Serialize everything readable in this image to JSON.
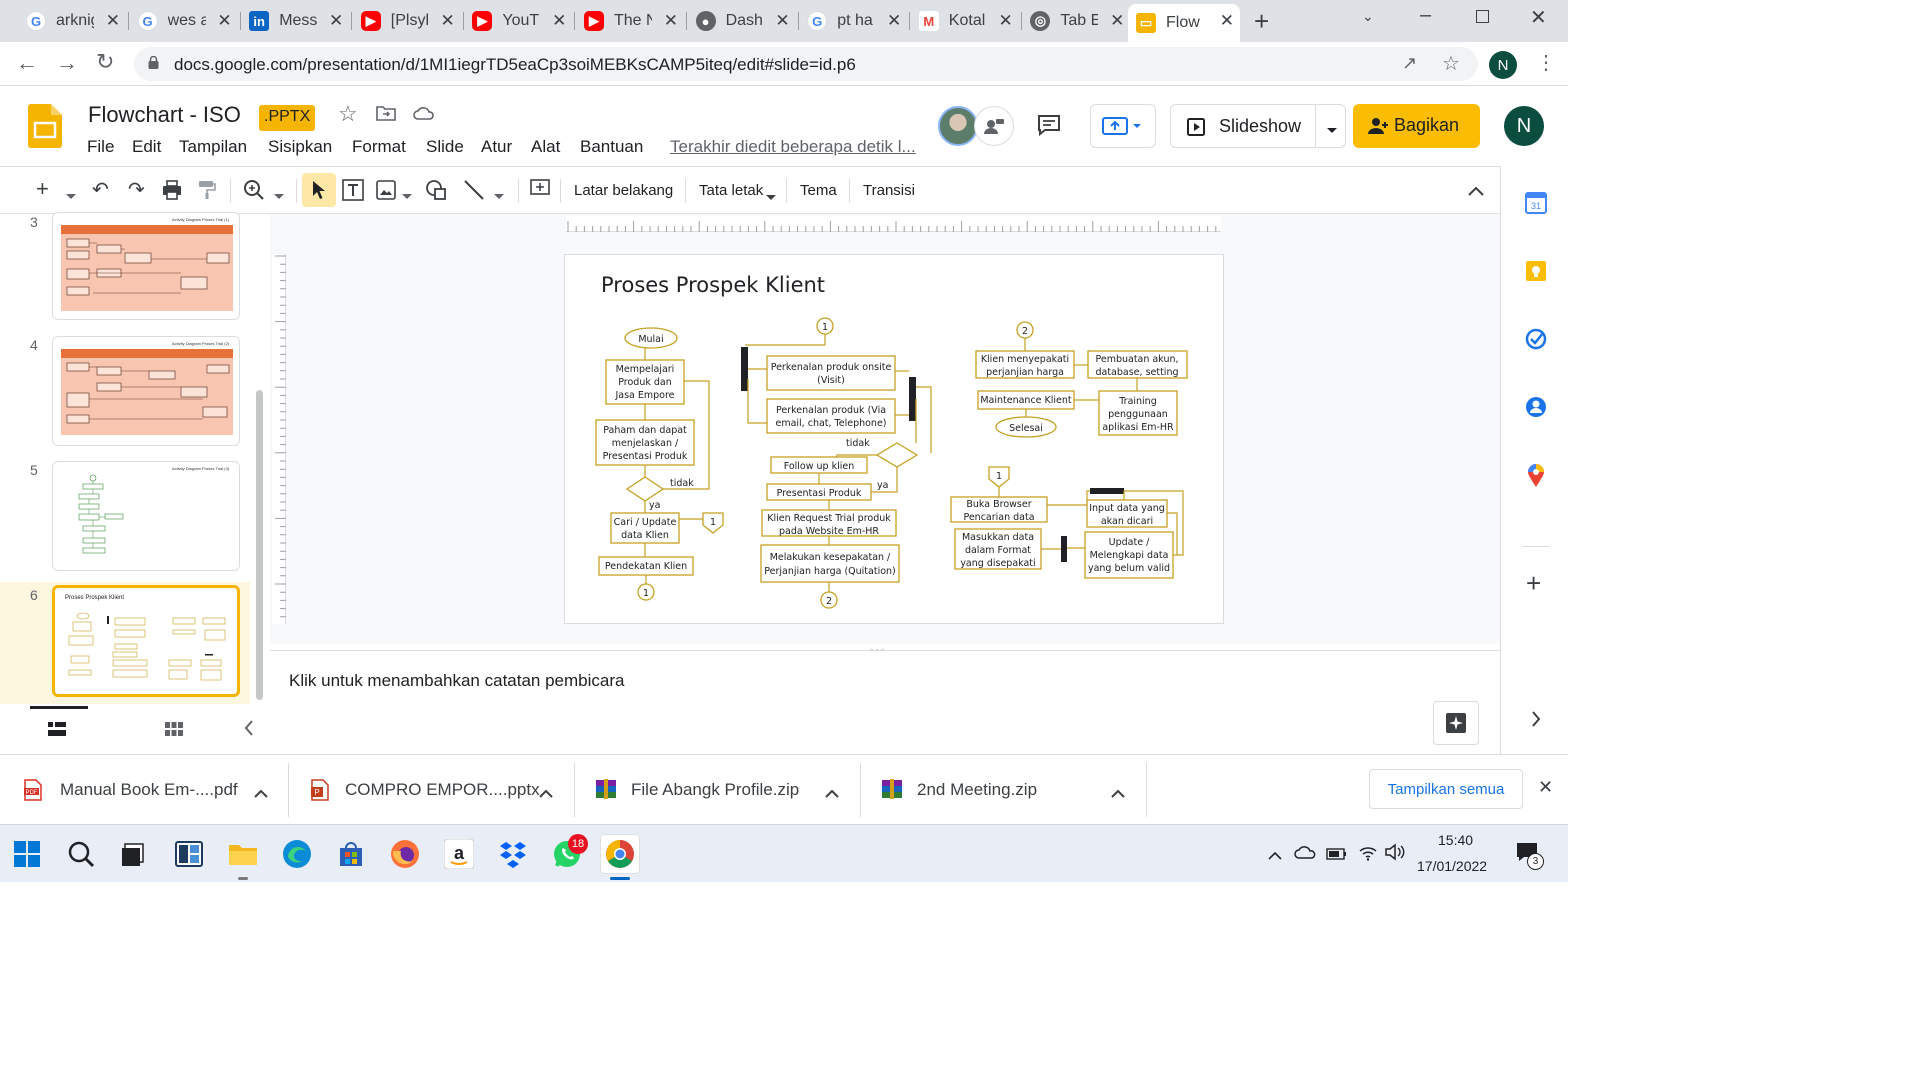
{
  "browser": {
    "tabs": [
      {
        "title": "arknig",
        "icon": "google-icon"
      },
      {
        "title": "wes a",
        "icon": "google-icon"
      },
      {
        "title": "Mess",
        "icon": "linkedin-icon"
      },
      {
        "title": "[Plsyl",
        "icon": "youtube-icon"
      },
      {
        "title": "YouT",
        "icon": "youtube-icon"
      },
      {
        "title": "The N",
        "icon": "youtube-icon"
      },
      {
        "title": "Dash",
        "icon": "globe-icon"
      },
      {
        "title": "pt ha",
        "icon": "google-icon"
      },
      {
        "title": "Kotal",
        "icon": "gmail-icon"
      },
      {
        "title": "Tab E",
        "icon": "chrome-icon"
      },
      {
        "title": "Flow",
        "icon": "slides-icon"
      }
    ],
    "url": "docs.google.com/presentation/d/1MI1iegrTD5eaCp3soiMEBKsCAMP5iteq/edit#slide=id.p6",
    "profile_initial": "N"
  },
  "app": {
    "title": "Flowchart - ISO",
    "badge": ".PPTX",
    "menu": [
      "File",
      "Edit",
      "Tampilan",
      "Sisipkan",
      "Format",
      "Slide",
      "Atur",
      "Alat",
      "Bantuan"
    ],
    "last_edit": "Terakhir diedit beberapa detik l...",
    "slideshow_label": "Slideshow",
    "share_label": "Bagikan",
    "user_initial": "N"
  },
  "toolbar": {
    "buttons": [
      "Latar belakang",
      "Tata letak",
      "Tema",
      "Transisi"
    ]
  },
  "filmstrip": {
    "slides": [
      {
        "num": "3",
        "caption": "Activity Diagram Proses Trial (1)"
      },
      {
        "num": "4",
        "caption": "Activity Diagram Proses Trial (2)"
      },
      {
        "num": "5",
        "caption": "Activity Diagram Proses Trial (3)"
      },
      {
        "num": "6",
        "caption": "Proses Prospek Klient"
      }
    ]
  },
  "slide": {
    "title": "Proses Prospek Klient",
    "nodes": {
      "mulai": "Mulai",
      "mempelajari": [
        "Mempelajari",
        "Produk dan",
        "Jasa Empore"
      ],
      "paham": [
        "Paham dan dapat",
        "menjelaskan /",
        "Presentasi Produk"
      ],
      "tidak1": "tidak",
      "ya1": "ya",
      "cari": [
        "Cari / Update",
        "data Klien"
      ],
      "pendekatan": "Pendekatan Klien",
      "c1a": "1",
      "c1b": "1",
      "c1c": "1",
      "c1d": "1",
      "perkenalan_onsite": [
        "Perkenalan produk onsite",
        "(Visit)"
      ],
      "perkenalan_via": [
        "Perkenalan produk (Via",
        "email, chat, Telephone)"
      ],
      "tidak2": "tidak",
      "followup": "Follow up klien",
      "presentasi": "Presentasi Produk",
      "ya2": "ya",
      "request": [
        "Klien Request Trial produk",
        "pada Website Em-HR"
      ],
      "kesepakatan": [
        "Melakukan kesepakatan /",
        "Perjanjian harga (Quitation)"
      ],
      "c2a": "2",
      "c2b": "2",
      "klien_sepakat": [
        "Klien menyepakati",
        "perjanjian harga"
      ],
      "pembuatan": [
        "Pembuatan akun,",
        "database, setting"
      ],
      "maintenance": "Maintenance Klient",
      "training": [
        "Training",
        "penggunaan",
        "aplikasi Em-HR"
      ],
      "selesai": "Selesai",
      "buka": [
        "Buka Browser",
        "Pencarian data"
      ],
      "input": [
        "Input data yang",
        "akan dicari"
      ],
      "masukkan": [
        "Masukkan data",
        "dalam Format",
        "yang disepakati"
      ],
      "update": [
        "Update /",
        "Melengkapi data",
        "yang belum valid"
      ]
    }
  },
  "notes": {
    "placeholder": "Klik untuk menambahkan catatan pembicara"
  },
  "downloads": {
    "items": [
      {
        "name": "Manual Book Em-....pdf",
        "icon": "pdf-icon"
      },
      {
        "name": "COMPRO EMPOR....pptx",
        "icon": "pptx-icon"
      },
      {
        "name": "File Abangk Profile.zip",
        "icon": "winrar-icon"
      },
      {
        "name": "2nd Meeting.zip",
        "icon": "winrar-icon"
      }
    ],
    "show_all": "Tampilkan semua"
  },
  "taskbar": {
    "whatsapp_badge": "18",
    "time": "15:40",
    "date": "17/01/2022",
    "notif_count": "3"
  },
  "colors": {
    "slides_yellow": "#f4b400",
    "share_button": "#fbbc04",
    "flow_stroke": "#c5a021"
  }
}
